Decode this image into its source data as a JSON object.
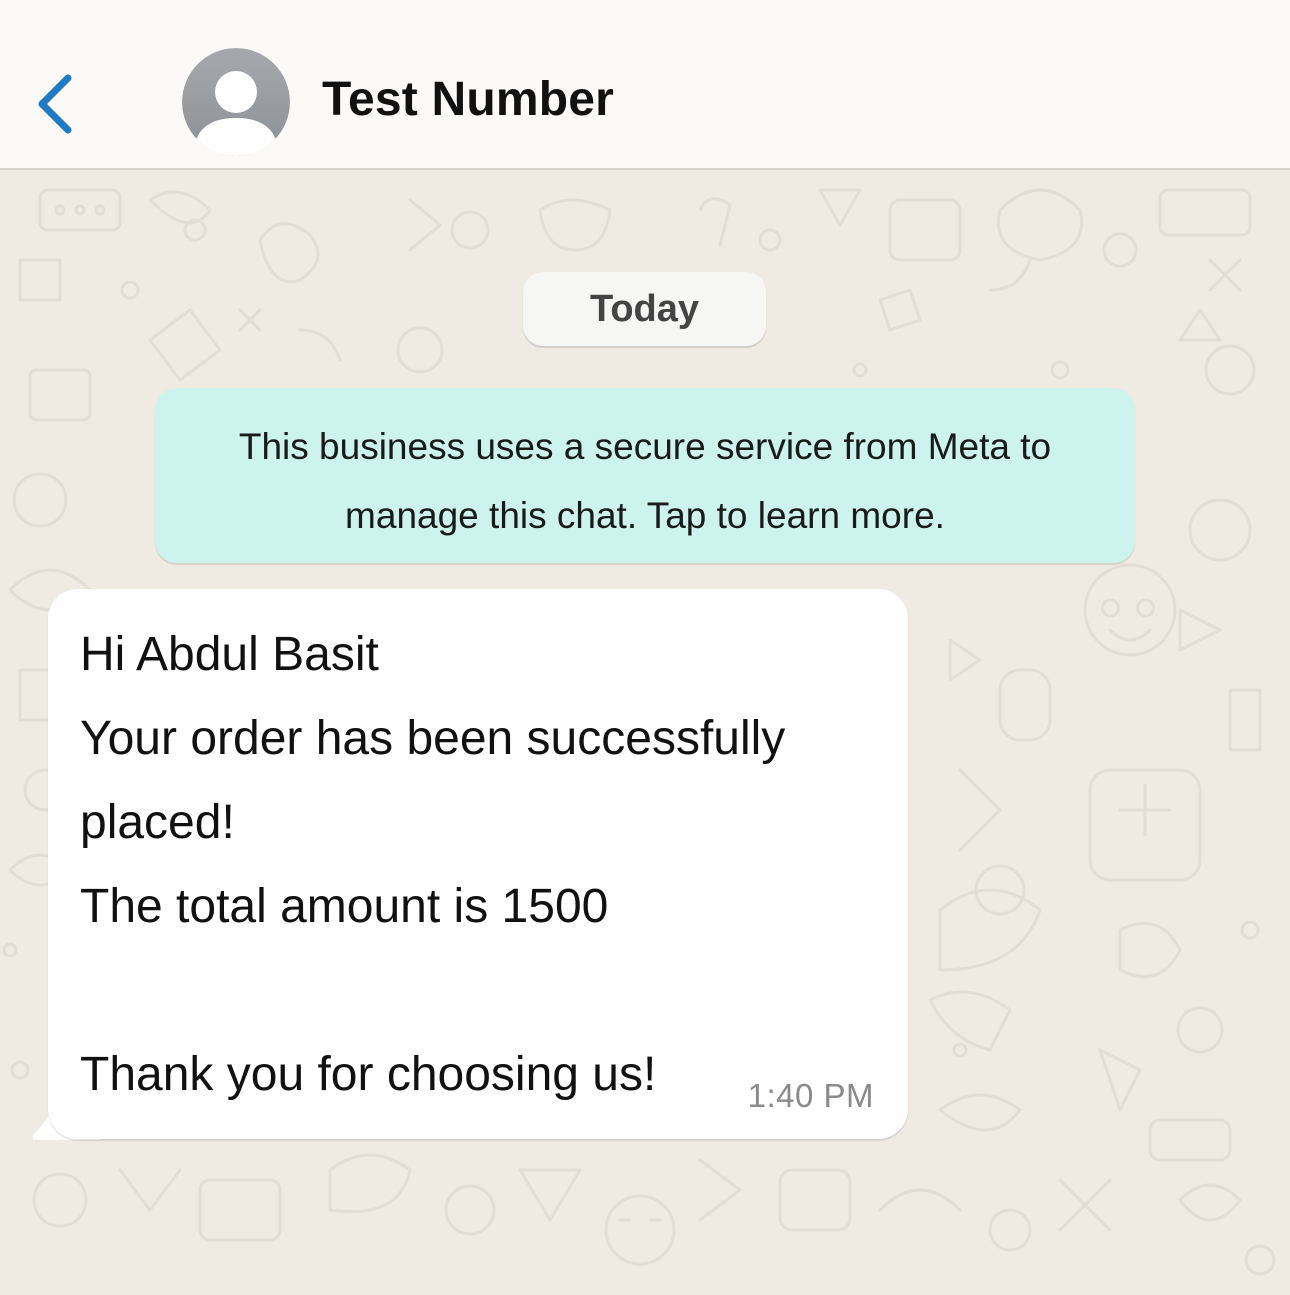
{
  "header": {
    "contact_name": "Test Number",
    "back_icon": "chevron-left-icon",
    "avatar_icon": "person-avatar-icon"
  },
  "chat": {
    "date_chip": "Today",
    "system_notice": {
      "line1": "This business uses a secure service from Meta to",
      "line2": "manage this chat. Tap to learn more."
    },
    "message": {
      "lines": [
        "Hi Abdul Basit",
        "Your order has been successfully",
        "placed!",
        "The total amount is 1500",
        "",
        "Thank you for choosing us!"
      ],
      "time": "1:40 PM"
    }
  },
  "colors": {
    "accent": "#1f7ac4",
    "chat_background": "#efeae2",
    "notice_background": "#ccf3ee",
    "bubble_background": "#ffffff"
  }
}
